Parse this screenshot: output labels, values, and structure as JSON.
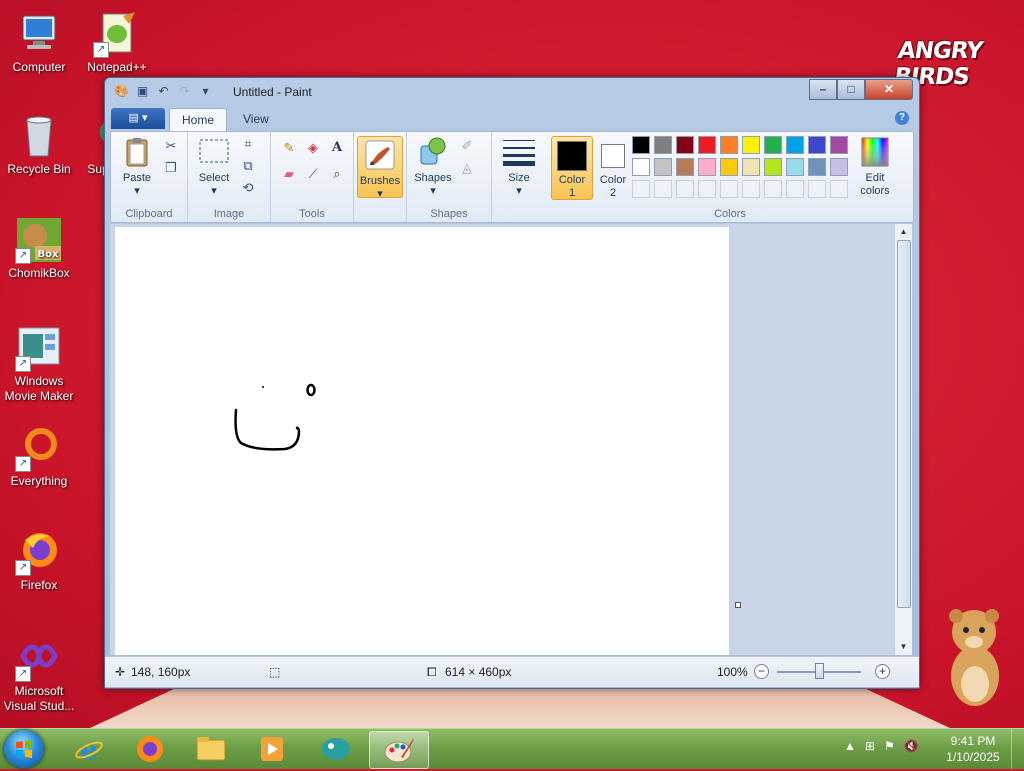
{
  "desktop": {
    "icons": [
      {
        "label": "Computer"
      },
      {
        "label": "Notepad++"
      },
      {
        "label": "Recycle Bin"
      },
      {
        "label": "Sup"
      },
      {
        "label": "ChomikBox"
      },
      {
        "label": "Windows Movie Maker"
      },
      {
        "label": "Everything"
      },
      {
        "label": "Firefox"
      },
      {
        "label": "Microsoft Visual Stud..."
      }
    ],
    "brand_logo": "ANGRY BIRDS"
  },
  "window": {
    "title": "Untitled - Paint",
    "tabs": {
      "home": "Home",
      "view": "View"
    },
    "help": "?"
  },
  "ribbon": {
    "clipboard": {
      "label": "Clipboard",
      "paste": "Paste"
    },
    "image": {
      "label": "Image",
      "select": "Select"
    },
    "tools": {
      "label": "Tools"
    },
    "brushes": {
      "label": "Brushes"
    },
    "shapes": {
      "label": "Shapes",
      "shapes_btn": "Shapes"
    },
    "size": {
      "label": "Size"
    },
    "colors": {
      "label": "Colors",
      "color1_line1": "Color",
      "color1_line2": "1",
      "color2_line1": "Color",
      "color2_line2": "2",
      "edit_line1": "Edit",
      "edit_line2": "colors",
      "color1": "#000000",
      "color2": "#ffffff",
      "palette_row1": [
        "#000000",
        "#7f7f7f",
        "#880015",
        "#ed1c24",
        "#ff7f27",
        "#fff200",
        "#22b14c",
        "#00a2e8",
        "#3f48cc",
        "#a349a4"
      ],
      "palette_row2": [
        "#ffffff",
        "#c3c3c3",
        "#b97a57",
        "#ffaec9",
        "#ffc90e",
        "#efe4b0",
        "#b5e61d",
        "#99d9ea",
        "#7092be",
        "#c8bfe7"
      ]
    }
  },
  "status": {
    "cursor_pos": "148, 160px",
    "canvas_size": "614 × 460px",
    "zoom": "100%"
  },
  "taskbar": {
    "time": "9:41 PM",
    "date": "1/10/2025"
  }
}
